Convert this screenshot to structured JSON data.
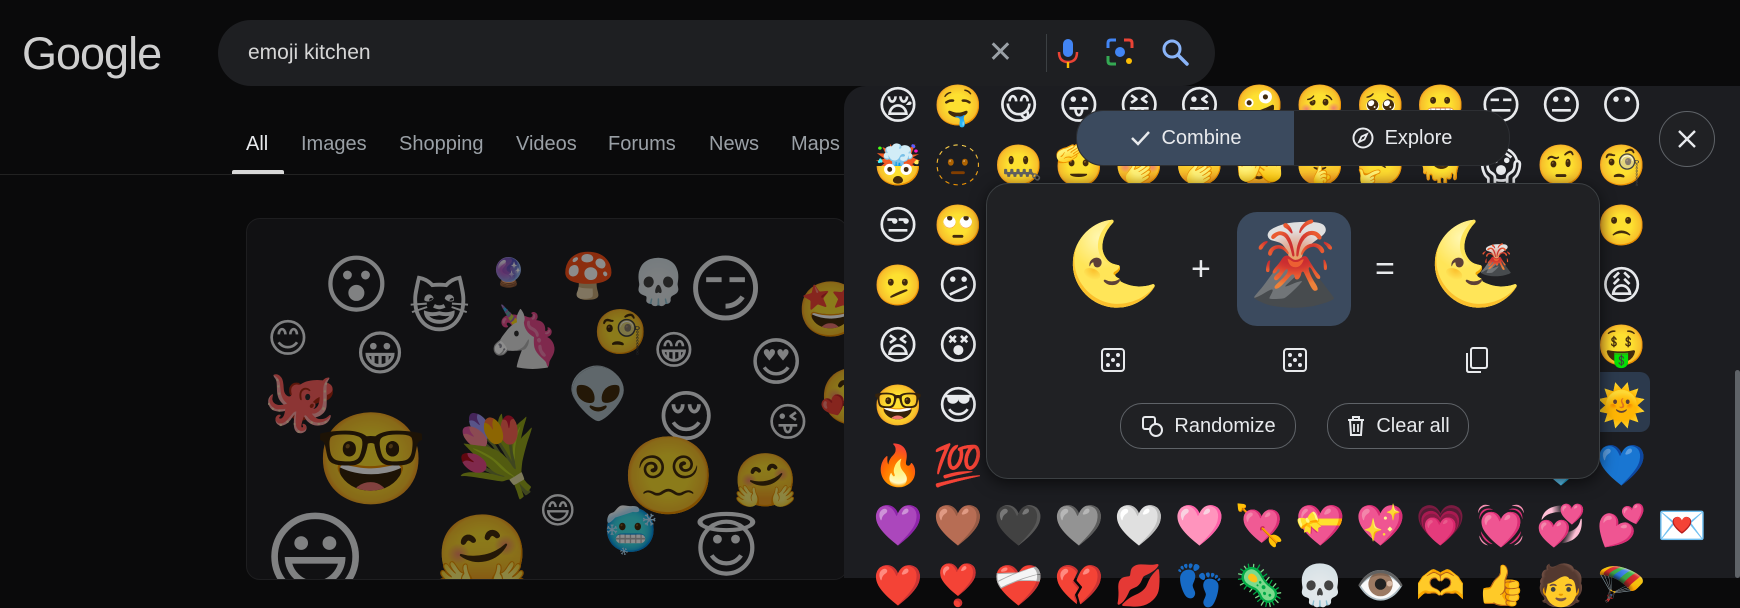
{
  "header": {
    "logo": "Google"
  },
  "search": {
    "query": "emoji kitchen",
    "icons": [
      "close-icon",
      "mic-icon",
      "lens-icon",
      "search-icon"
    ]
  },
  "nav": {
    "tabs": [
      "All",
      "Images",
      "Shopping",
      "Videos",
      "Forums",
      "News",
      "Maps"
    ],
    "active": "All"
  },
  "result_card": {
    "emojis": [
      "😮",
      "😺",
      "🍄",
      "💀",
      "😏",
      "🔮",
      "😊",
      "🤩",
      "🐙",
      "😀",
      "🦄",
      "🧐",
      "😁",
      "😍",
      "👽",
      "🥰",
      "😜",
      "🤓",
      "💐",
      "😌",
      "🤗",
      "😵‍💫",
      "😄",
      "🥶",
      "😇",
      "😃",
      "🤗"
    ]
  },
  "kitchen": {
    "mode_toggle": {
      "combine": "Combine",
      "explore": "Explore",
      "selected": "Combine"
    },
    "grid_rows": [
      [
        "😪",
        "🤤",
        "😋",
        "😛",
        "😝",
        "😜",
        "🤪",
        "🥴",
        "🥺",
        "😬",
        "😑",
        "😐",
        "😶"
      ],
      [
        "🤯",
        "🫥",
        "🤐",
        "🫡",
        "🤭",
        "🫢",
        "🫣",
        "🤫",
        "🤔",
        "🫠",
        "😱",
        "🤨",
        "🧐"
      ],
      [
        "😒",
        "🙄",
        "",
        "",
        "",
        "",
        "",
        "",
        "",
        "",
        "",
        "☹️",
        "🙁"
      ],
      [
        "🫤",
        "😕",
        "",
        "",
        "",
        "",
        "",
        "",
        "",
        "",
        "",
        "😣",
        "😩"
      ],
      [
        "😫",
        "😵",
        "",
        "",
        "",
        "",
        "",
        "",
        "",
        "",
        "",
        "🤠",
        "🤑"
      ],
      [
        "🤓",
        "😎",
        "",
        "",
        "",
        "",
        "",
        "",
        "",
        "",
        "",
        "🌜",
        "🌞"
      ],
      [
        "🔥",
        "💯",
        "",
        "",
        "",
        "",
        "",
        "",
        "",
        "",
        "",
        "🩵",
        "💙"
      ],
      [
        "💜",
        "🤎",
        "🖤",
        "🩶",
        "🤍",
        "🩷",
        "💘",
        "💝",
        "💖",
        "💗",
        "💓",
        "💞",
        "💕",
        "💌"
      ],
      [
        "❤️",
        "❣️",
        "❤️‍🩹",
        "💔",
        "💋",
        "👣",
        "🦠",
        "💀",
        "👁️",
        "🫶",
        "👍",
        "🧑",
        "🪂"
      ]
    ],
    "mixer": {
      "left_emoji": "🌜",
      "right_emoji": "🌋",
      "result_emoji": "🌜",
      "result_overlay": "🌋",
      "plus": "+",
      "equals": "=",
      "randomize_label": "Randomize",
      "clear_label": "Clear all"
    }
  }
}
